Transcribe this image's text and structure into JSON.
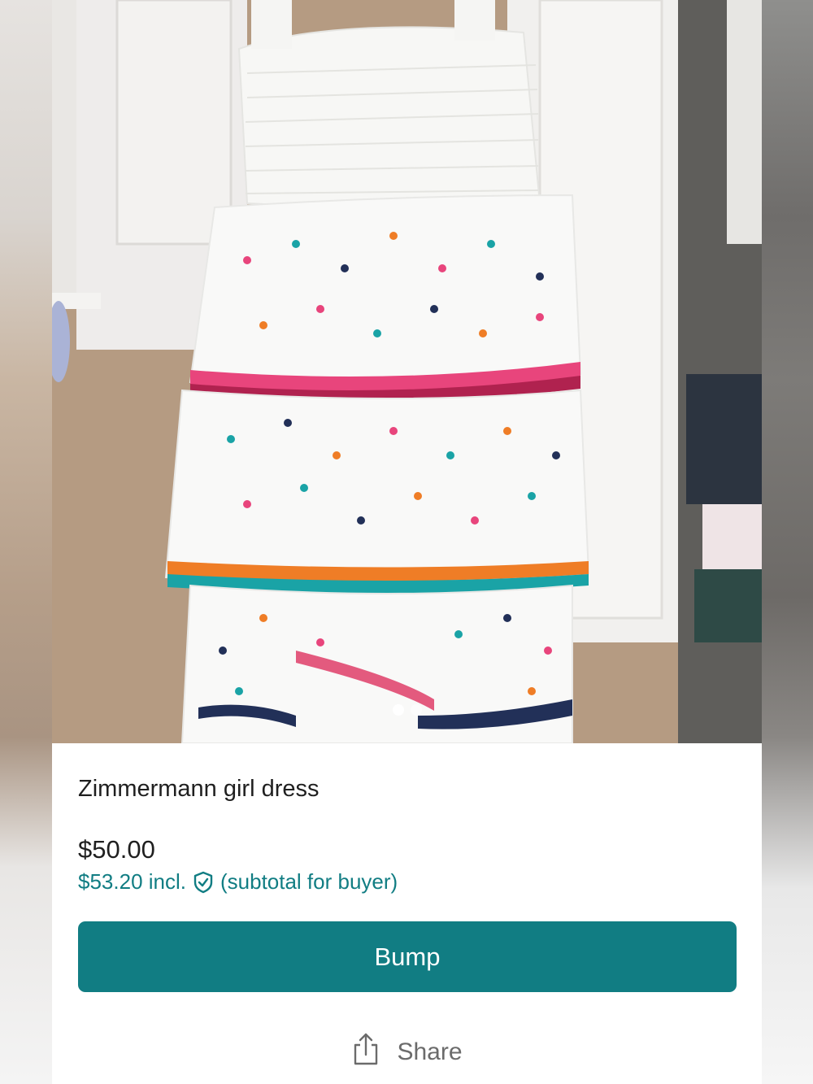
{
  "listing": {
    "title": "Zimmermann girl dress",
    "price": "$50.00",
    "subtotal_amount": "$53.20 incl.",
    "subtotal_note": "(subtotal for buyer)",
    "subtotal_icon": "shield-check-icon"
  },
  "actions": {
    "bump_label": "Bump",
    "share_label": "Share",
    "share_icon": "share-icon"
  },
  "gallery": {
    "image_count": 2,
    "active_index": 0
  },
  "colors": {
    "accent": "#117d83",
    "text": "#1f1f1f",
    "muted": "#6b6b6b"
  }
}
